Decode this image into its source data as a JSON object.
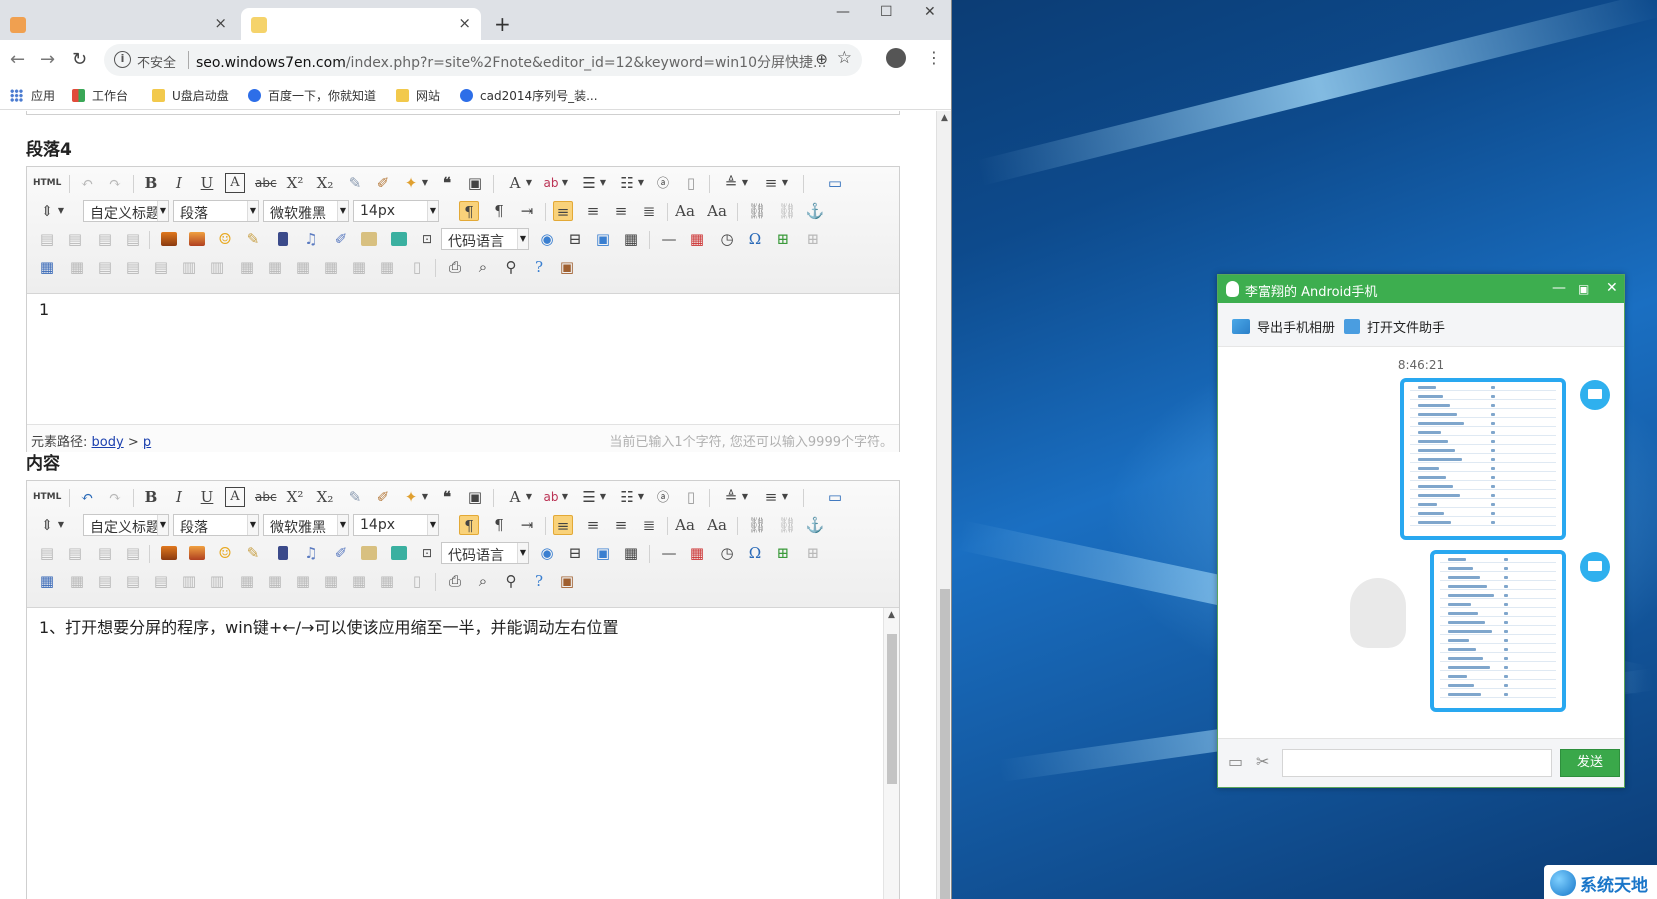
{
  "browser": {
    "tabs": [
      {
        "title": "",
        "close": "×",
        "active": false
      },
      {
        "title": "",
        "close": "×",
        "active": true
      }
    ],
    "new_tab": "+",
    "window_controls": {
      "minimize": "—",
      "maximize": "☐",
      "close": "✕"
    },
    "address": {
      "security_label": "不安全",
      "host": "seo.windows7en.com",
      "path": "/index.php?r=site%2Fnote&editor_id=12&keyword=win10分屏快捷..."
    },
    "bookmarks": [
      {
        "label": "应用",
        "icon": "apps-grid-icon",
        "color": "#4a7bd0"
      },
      {
        "label": "工作台",
        "icon": "workbench-icon",
        "color": "#e24b3b"
      },
      {
        "label": "U盘启动盘",
        "icon": "folder-icon",
        "color": "#f2c94c"
      },
      {
        "label": "百度一下，你就知道",
        "icon": "baidu-paw-icon",
        "color": "#2d6ee8"
      },
      {
        "label": "网站",
        "icon": "folder-icon",
        "color": "#f2c94c"
      },
      {
        "label": "cad2014序列号_装...",
        "icon": "baidu-paw-icon",
        "color": "#2d6ee8"
      }
    ]
  },
  "page": {
    "section1_title": "段落4",
    "section2_title": "内容",
    "toolbar": {
      "html_label": "HTML",
      "heading_combo": "自定义标题",
      "paragraph_combo": "段落",
      "font_combo": "微软雅黑",
      "size_combo": "14px",
      "code_combo": "代码语言"
    },
    "editor1": {
      "content": "1",
      "path_label": "元素路径:",
      "path_body": "body",
      "path_sep": ">",
      "path_p": "p",
      "count_text": "当前已输入1个字符, 您还可以输入9999个字符。"
    },
    "editor2": {
      "content": "1、打开想要分屏的程序，win键+←/→可以使该应用缩至一半，并能调动左右位置"
    }
  },
  "qq": {
    "title": "李富翔的 Android手机",
    "controls": {
      "minimize": "—",
      "maximize": "▣",
      "close": "✕"
    },
    "actions": {
      "export_album": "导出手机相册",
      "open_file_helper": "打开文件助手"
    },
    "time": "8:46:21",
    "send_label": "发送",
    "accent": "#3dae4f"
  },
  "watermark": {
    "text": "系统天地"
  }
}
